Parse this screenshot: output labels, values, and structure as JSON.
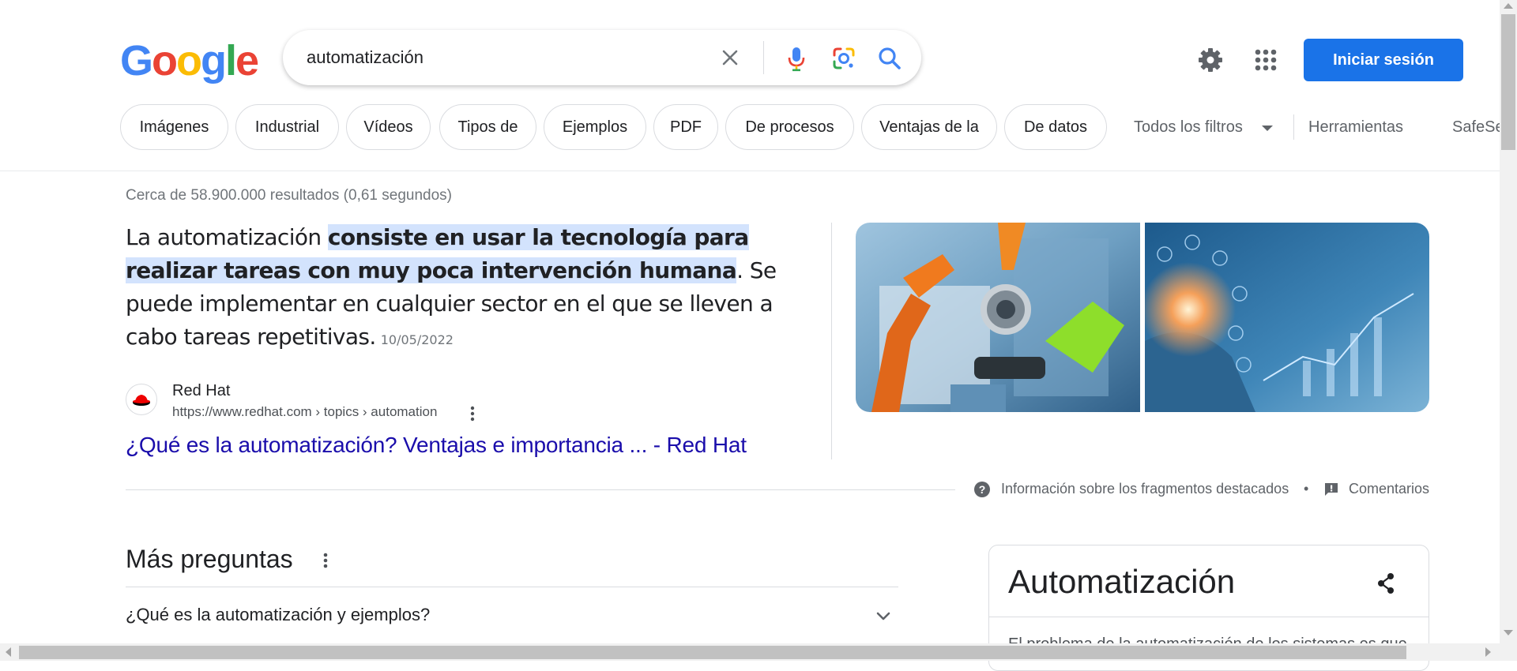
{
  "header": {
    "logo": [
      "G",
      "o",
      "o",
      "g",
      "l",
      "e"
    ],
    "logo_colors": [
      "#4285f4",
      "#ea4335",
      "#fbbc05",
      "#4285f4",
      "#34a853",
      "#ea4335"
    ],
    "search_query": "automatización",
    "signin_label": "Iniciar sesión"
  },
  "icons": {
    "clear": "close-icon",
    "mic": "microphone-icon",
    "lens": "google-lens-icon",
    "search": "search-icon",
    "settings": "gear-icon",
    "apps": "apps-grid-icon"
  },
  "filters": {
    "chips": [
      "Imágenes",
      "Industrial",
      "Vídeos",
      "Tipos de",
      "Ejemplos",
      "PDF",
      "De procesos",
      "Ventajas de la",
      "De datos"
    ],
    "all_filters": "Todos los filtros",
    "tools": "Herramientas",
    "safesearch": "SafeSe"
  },
  "results": {
    "stats": "Cerca de 58.900.000 resultados (0,61 segundos)",
    "snippet": {
      "before": "La automatización ",
      "highlight": "consiste en usar la tecnología para realizar tareas con muy poca intervención humana",
      "after": ". Se puede implementar en cualquier sector en el que se lleven a cabo tareas repetitivas.",
      "date": "10/05/2022"
    },
    "source": {
      "name": "Red Hat",
      "url": "https://www.redhat.com › topics › automation"
    },
    "link": "¿Qué es la automatización? Ventajas e importancia ... - Red Hat",
    "about_snippets": "Información sobre los fragmentos destacados",
    "separator_dot": "•",
    "feedback": "Comentarios"
  },
  "people_also_ask": {
    "title": "Más preguntas",
    "questions": [
      "¿Qué es la automatización y ejemplos?"
    ]
  },
  "knowledge_panel": {
    "title": "Automatización",
    "preview": "El problema de la automatización de los sistemas es que..."
  },
  "colors": {
    "accent": "#1a73e8",
    "link": "#1a0dab",
    "highlight": "#d3e3fd"
  }
}
